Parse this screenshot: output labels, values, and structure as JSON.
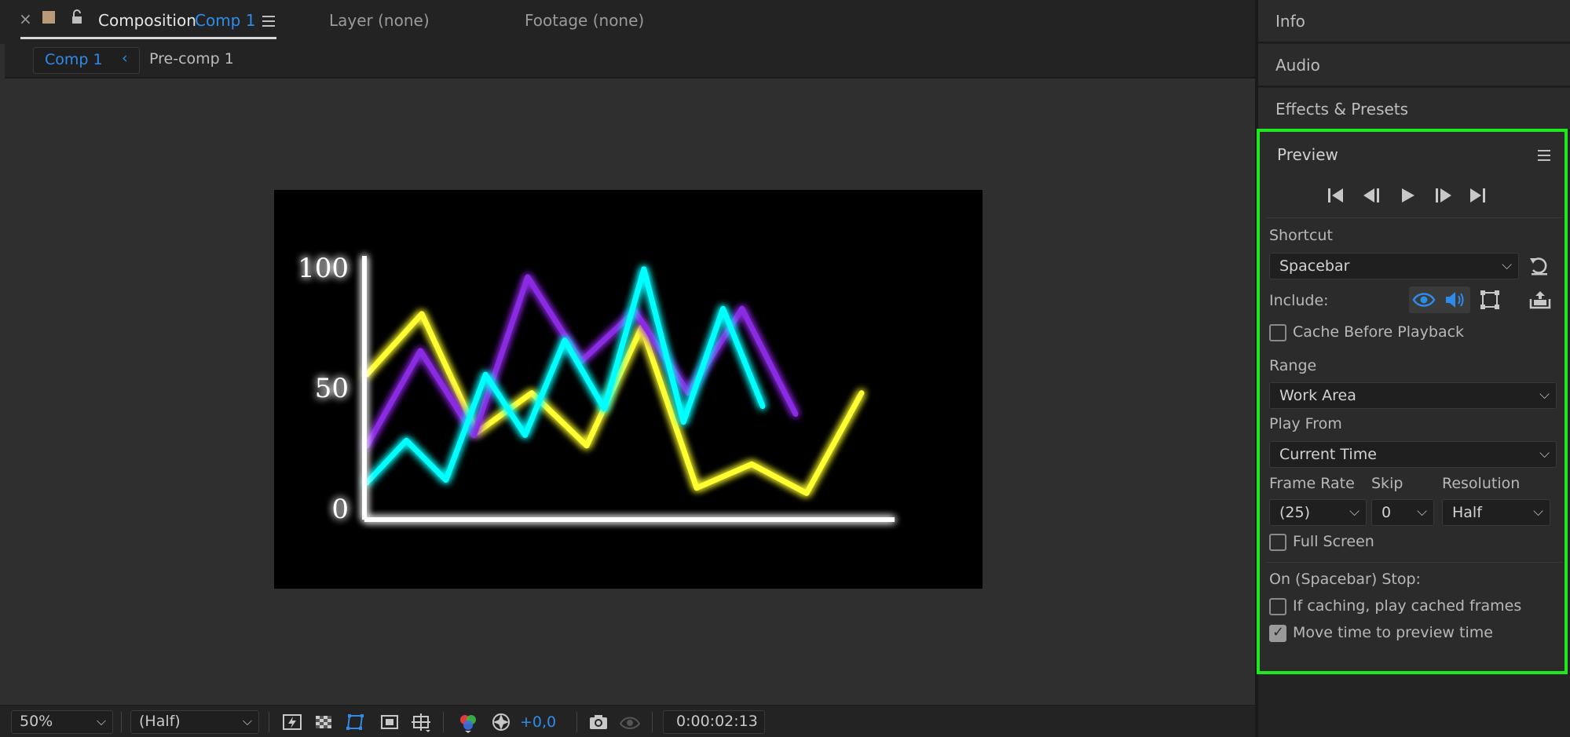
{
  "comp_panel": {
    "tabs": {
      "close": "×",
      "composition_label": "Composition",
      "composition_name": "Comp 1",
      "layer": "Layer (none)",
      "footage": "Footage (none)"
    },
    "breadcrumbs": [
      "Comp 1",
      "Pre-comp 1"
    ]
  },
  "chart_data": {
    "type": "line",
    "ytick_labels": [
      "100",
      "50",
      "0"
    ],
    "ylim": [
      0,
      100
    ],
    "x": [
      0,
      1,
      2,
      3,
      4,
      5,
      6,
      7,
      8,
      9,
      10,
      11,
      12,
      13,
      14,
      15,
      16
    ],
    "series": [
      {
        "color": "#ffff33",
        "values": [
          55,
          78,
          33,
          48,
          28,
          73,
          12,
          21,
          10,
          48
        ]
      },
      {
        "color": "#8a2be2",
        "values": [
          28,
          64,
          32,
          92,
          60,
          79,
          48,
          80,
          40
        ]
      },
      {
        "color": "#00ffff",
        "values": [
          14,
          30,
          15,
          55,
          32,
          68,
          42,
          95,
          37,
          80,
          43
        ]
      }
    ]
  },
  "bottom_bar": {
    "zoom": "50%",
    "resolution": "(Half)",
    "exposure": "+0,0",
    "timecode": "0:00:02:13"
  },
  "right_panels": {
    "info": "Info",
    "audio": "Audio",
    "effects": "Effects & Presets"
  },
  "preview": {
    "title": "Preview",
    "shortcut_label": "Shortcut",
    "shortcut_value": "Spacebar",
    "include_label": "Include:",
    "cache_before_playback": "Cache Before Playback",
    "range_label": "Range",
    "range_value": "Work Area",
    "play_from_label": "Play From",
    "play_from_value": "Current Time",
    "frame_rate_label": "Frame Rate",
    "frame_rate_value": "(25)",
    "skip_label": "Skip",
    "skip_value": "0",
    "resolution_label": "Resolution",
    "resolution_value": "Half",
    "full_screen": "Full Screen",
    "on_stop_label": "On (Spacebar) Stop:",
    "if_caching": "If caching, play cached frames",
    "move_time": "Move time to preview time",
    "outline_color": "#1ee81e",
    "accent_color": "#2d8ceb"
  }
}
